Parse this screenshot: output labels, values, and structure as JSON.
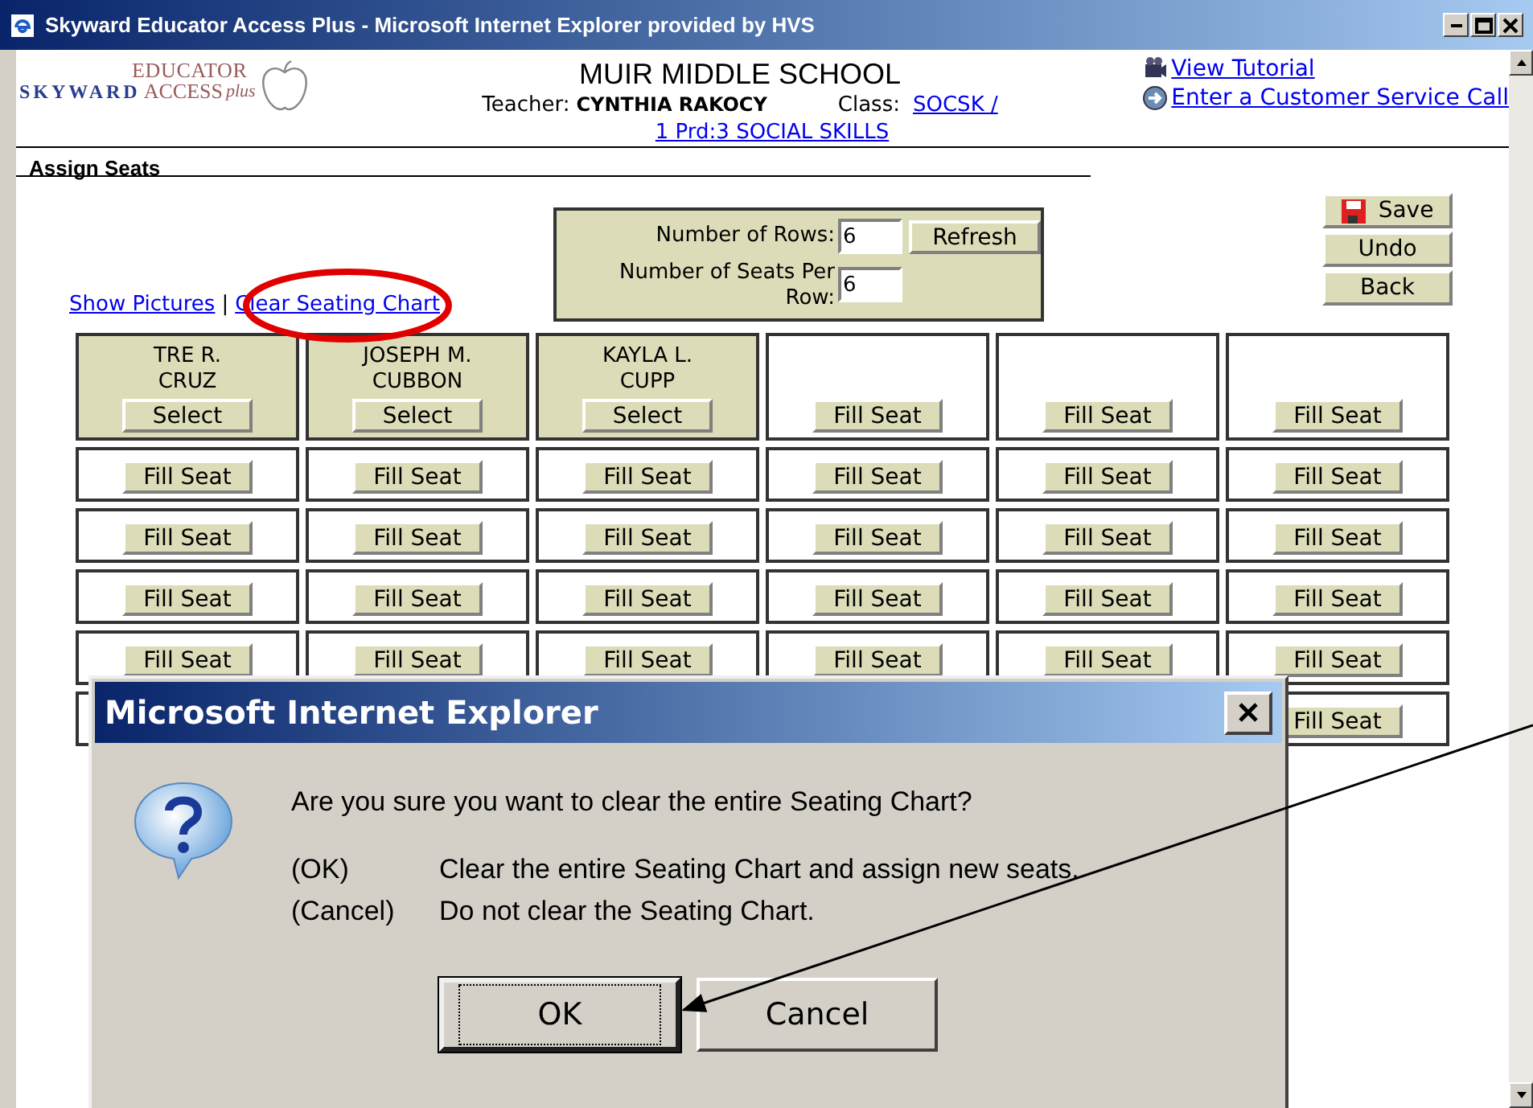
{
  "window": {
    "title": "Skyward Educator Access Plus - Microsoft Internet Explorer provided by HVS"
  },
  "logo": {
    "brand": "SKYWARD",
    "product": "EDUCATOR",
    "line2": "ACCESS",
    "suffix": "plus"
  },
  "header": {
    "school": "MUIR MIDDLE SCHOOL",
    "teacher_label": "Teacher:",
    "teacher": "CYNTHIA RAKOCY",
    "class_label": "Class:",
    "class_link": "SOCSK /",
    "class_link_2": "1 Prd:3 SOCIAL SKILLS"
  },
  "help_links": [
    {
      "kind": "tutorial",
      "label": "View Tutorial"
    },
    {
      "kind": "service",
      "label": "Enter a Customer Service Call"
    }
  ],
  "page_title": "Assign Seats",
  "settings": {
    "rows_label": "Number of Rows:",
    "rows_value": "6",
    "refresh": "Refresh",
    "seats_label": "Number of Seats Per Row:",
    "seats_value": "6"
  },
  "actions": [
    {
      "kind": "save",
      "label": "Save"
    },
    {
      "kind": "plain",
      "label": "Undo"
    },
    {
      "kind": "plain",
      "label": "Back"
    }
  ],
  "chart_links": {
    "show_pictures": "Show Pictures",
    "separator": "|",
    "clear": "Clear Seating Chart"
  },
  "seat_rows": [
    [
      {
        "kind": "student",
        "first": "TRE R.",
        "last": "CRUZ",
        "button": "Select"
      },
      {
        "kind": "student",
        "first": "JOSEPH M.",
        "last": "CUBBON",
        "button": "Select"
      },
      {
        "kind": "student",
        "first": "KAYLA L.",
        "last": "CUPP",
        "button": "Select"
      },
      {
        "kind": "open",
        "button": "Fill Seat"
      },
      {
        "kind": "open",
        "button": "Fill Seat"
      },
      {
        "kind": "open",
        "button": "Fill Seat"
      }
    ],
    [
      {
        "kind": "open",
        "button": "Fill Seat"
      },
      {
        "kind": "open",
        "button": "Fill Seat"
      },
      {
        "kind": "open",
        "button": "Fill Seat"
      },
      {
        "kind": "open",
        "button": "Fill Seat"
      },
      {
        "kind": "open",
        "button": "Fill Seat"
      },
      {
        "kind": "open",
        "button": "Fill Seat"
      }
    ],
    [
      {
        "kind": "open",
        "button": "Fill Seat"
      },
      {
        "kind": "open",
        "button": "Fill Seat"
      },
      {
        "kind": "open",
        "button": "Fill Seat"
      },
      {
        "kind": "open",
        "button": "Fill Seat"
      },
      {
        "kind": "open",
        "button": "Fill Seat"
      },
      {
        "kind": "open",
        "button": "Fill Seat"
      }
    ],
    [
      {
        "kind": "open",
        "button": "Fill Seat"
      },
      {
        "kind": "open",
        "button": "Fill Seat"
      },
      {
        "kind": "open",
        "button": "Fill Seat"
      },
      {
        "kind": "open",
        "button": "Fill Seat"
      },
      {
        "kind": "open",
        "button": "Fill Seat"
      },
      {
        "kind": "open",
        "button": "Fill Seat"
      }
    ],
    [
      {
        "kind": "open",
        "button": "Fill Seat"
      },
      {
        "kind": "open",
        "button": "Fill Seat"
      },
      {
        "kind": "open",
        "button": "Fill Seat"
      },
      {
        "kind": "open",
        "button": "Fill Seat"
      },
      {
        "kind": "open",
        "button": "Fill Seat"
      },
      {
        "kind": "open",
        "button": "Fill Seat"
      }
    ],
    [
      {
        "kind": "open",
        "button": "Fill Seat"
      }
    ]
  ],
  "dialog": {
    "title": "Microsoft Internet Explorer",
    "question": "Are you sure you want to clear the entire Seating Chart?",
    "options": [
      {
        "key": "(OK)",
        "text": "Clear the entire Seating Chart and assign new seats."
      },
      {
        "key": "(Cancel)",
        "text": "Do not clear the Seating Chart."
      }
    ],
    "buttons": [
      {
        "label": "OK",
        "selected": true
      },
      {
        "label": "Cancel",
        "selected": false
      }
    ]
  }
}
